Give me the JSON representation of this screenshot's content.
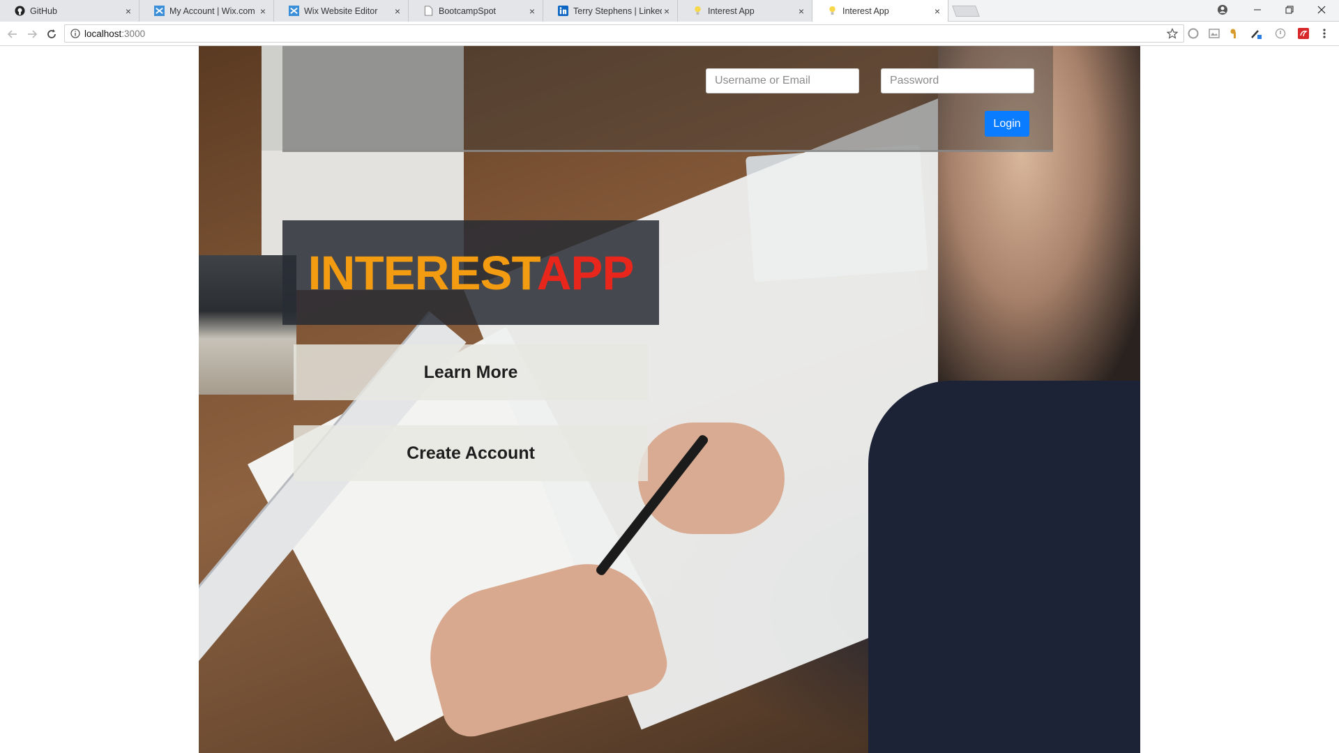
{
  "browser": {
    "tabs": [
      {
        "label": "GitHub",
        "icon": "github-icon"
      },
      {
        "label": "My Account | Wix.com",
        "icon": "wix-icon"
      },
      {
        "label": "Wix Website Editor",
        "icon": "wix-icon"
      },
      {
        "label": "BootcampSpot",
        "icon": "document-icon"
      },
      {
        "label": "Terry Stephens | LinkedIn",
        "icon": "linkedin-icon"
      },
      {
        "label": "Interest App",
        "icon": "lightbulb-icon"
      },
      {
        "label": "Interest App",
        "icon": "lightbulb-icon",
        "active": true
      }
    ],
    "url_host": "localhost",
    "url_port": ":3000"
  },
  "header": {
    "username_placeholder": "Username or Email",
    "password_placeholder": "Password",
    "login_label": "Login"
  },
  "brand": {
    "part1": "INTEREST",
    "part2": "APP",
    "color1": "#f39c12",
    "color2": "#e8261c"
  },
  "actions": {
    "learn_more_label": "Learn More",
    "create_account_label": "Create Account"
  },
  "colors": {
    "login_button": "#0a7cff"
  }
}
